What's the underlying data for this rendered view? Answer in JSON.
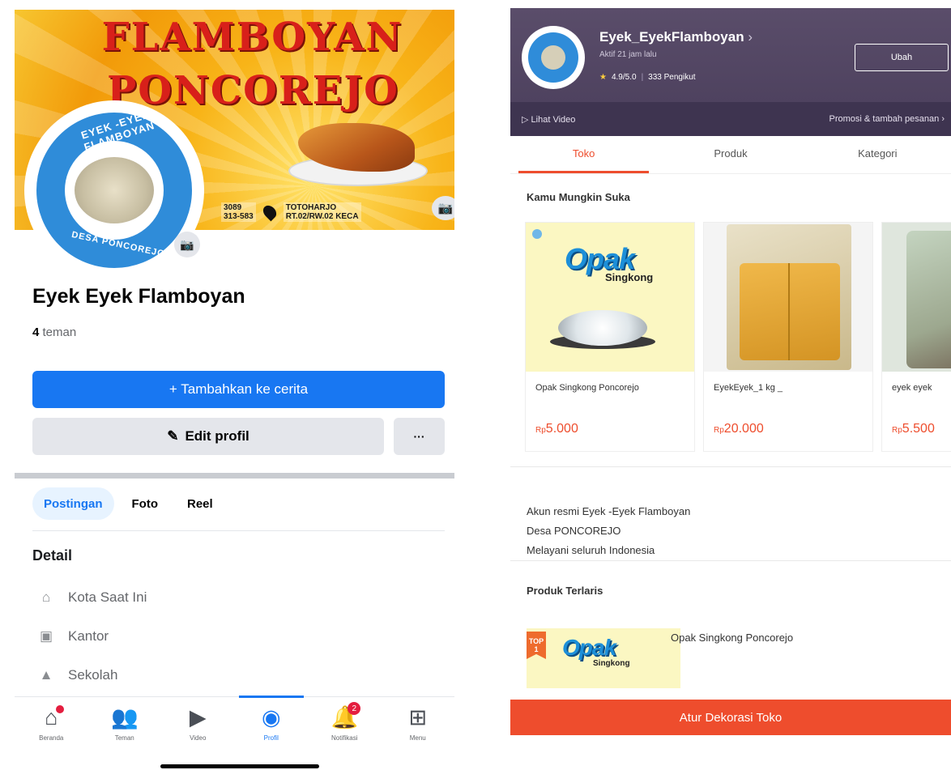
{
  "facebook": {
    "cover": {
      "title_line1": "FLAMBOYAN",
      "title_line2": "PONCOREJO",
      "phone": "3089\n313-583",
      "address": "TOTOHARJO\nRT.02/RW.02 KECA"
    },
    "avatar": {
      "ring_top": "EYEK -EYEK FLAMBOYAN",
      "ring_bottom": "DESA PONCOREJO"
    },
    "profile_name": "Eyek Eyek Flamboyan",
    "friends_count": "4",
    "friends_label": "teman",
    "story_button": "+ Tambahkan ke cerita",
    "edit_button": "Edit profil",
    "more_button": "···",
    "tabs": [
      {
        "label": "Postingan"
      },
      {
        "label": "Foto"
      },
      {
        "label": "Reel"
      }
    ],
    "detail_title": "Detail",
    "details": [
      {
        "label": "Kota Saat Ini",
        "icon": "home-icon"
      },
      {
        "label": "Kantor",
        "icon": "briefcase-icon"
      },
      {
        "label": "Sekolah",
        "icon": "graduation-cap-icon"
      }
    ],
    "nav": [
      {
        "label": "Beranda",
        "icon": "home-icon"
      },
      {
        "label": "Teman",
        "icon": "friends-icon"
      },
      {
        "label": "Video",
        "icon": "video-icon"
      },
      {
        "label": "Profil",
        "icon": "profile-icon"
      },
      {
        "label": "Notifikasi",
        "icon": "bell-icon",
        "badge": "2"
      },
      {
        "label": "Menu",
        "icon": "menu-grid-icon"
      }
    ],
    "colors": {
      "accent": "#1877f2"
    }
  },
  "shopee": {
    "shop_name": "Eyek_EyekFlamboyan",
    "active_status": "Aktif 21 jam lalu",
    "rating": "4.9/5.0",
    "followers": "333 Pengikut",
    "follow_button": "Ubah",
    "video_link": "Lihat Video",
    "promo_link": "Promosi & tambah pesanan",
    "tabs": [
      {
        "label": "Toko"
      },
      {
        "label": "Produk"
      },
      {
        "label": "Kategori"
      }
    ],
    "section_recommend": "Kamu Mungkin Suka",
    "products": [
      {
        "name": "Opak Singkong Poncorejo",
        "currency": "Rp",
        "price": "5.000"
      },
      {
        "name": "EyekEyek_1 kg _",
        "currency": "Rp",
        "price": "20.000"
      },
      {
        "name": "eyek eyek",
        "currency": "Rp",
        "price": "5.500"
      }
    ],
    "product_image": {
      "word": "Opak",
      "sub": "Singkong"
    },
    "description": [
      "Akun resmi Eyek -Eyek Flamboyan",
      "Desa PONCOREJO",
      "Melayani seluruh Indonesia"
    ],
    "section_best": "Produk Terlaris",
    "best_badge": "TOP\n1",
    "best_product": "Opak Singkong Poncorejo",
    "bottom_button": "Atur Dekorasi Toko",
    "colors": {
      "accent": "#ee4d2d",
      "header": "#4b3f5c"
    }
  }
}
